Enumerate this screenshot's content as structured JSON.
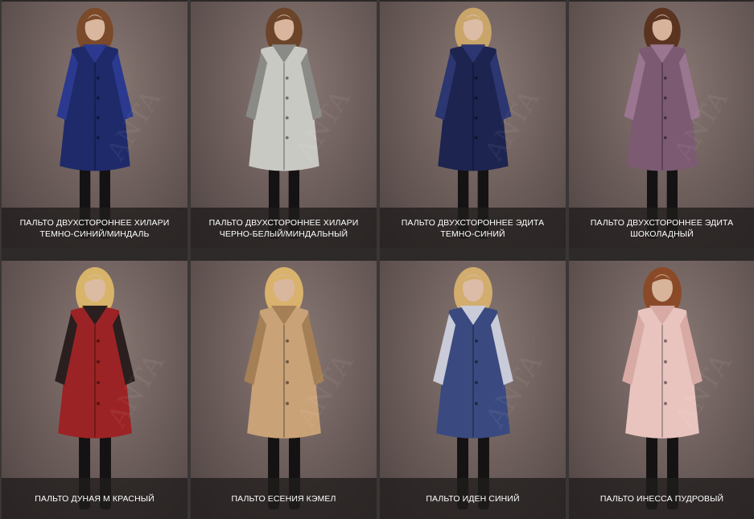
{
  "catalog": {
    "items": [
      {
        "name": "ПАЛЬТО ДВУХСТОРОННЕЕ ХИЛАРИ ТЕМНО-СИНИЙ/МИНДАЛЬ",
        "coat_color": "#1f2a6b",
        "accent": "#2b3a8f",
        "skin": "#d9b79e",
        "hair": "#7a4a2a"
      },
      {
        "name": "ПАЛЬТО ДВУХСТОРОННЕЕ ХИЛАРИ ЧЕРНО-БЕЛЫЙ/МИНДАЛЬНЫЙ",
        "coat_color": "#c9c9c4",
        "accent": "#8a8a86",
        "skin": "#d8b59c",
        "hair": "#6b4429"
      },
      {
        "name": "ПАЛЬТО ДВУХСТОРОННЕЕ ЭДИТА ТЕМНО-СИНИЙ",
        "coat_color": "#1d2450",
        "accent": "#2c3670",
        "skin": "#ddbca5",
        "hair": "#c9a56a"
      },
      {
        "name": "ПАЛЬТО ДВУХСТОРОННЕЕ ЭДИТА ШОКОЛАДНЫЙ",
        "coat_color": "#7b5a72",
        "accent": "#9a7690",
        "skin": "#d7b39b",
        "hair": "#5a3420"
      },
      {
        "name": "ПАЛЬТО ДУНАЯ М КРАСНЫЙ",
        "coat_color": "#9c2325",
        "accent": "#2a1e1e",
        "skin": "#dcbba3",
        "hair": "#d8b46a"
      },
      {
        "name": "ПАЛЬТО ЕСЕНИЯ КЭМЕЛ",
        "coat_color": "#c9a277",
        "accent": "#a57f55",
        "skin": "#d9b79e",
        "hair": "#d9b26d"
      },
      {
        "name": "ПАЛЬТО ИДЕН СИНИЙ",
        "coat_color": "#3a4a80",
        "accent": "#c9cbd8",
        "skin": "#dcbca6",
        "hair": "#d2ad6e"
      },
      {
        "name": "ПАЛЬТО ИНЕССА ПУДРОВЫЙ",
        "coat_color": "#e9c4bf",
        "accent": "#d8aaa4",
        "skin": "#d8b49b",
        "hair": "#8a4a28"
      }
    ],
    "watermark": "ANTA"
  }
}
